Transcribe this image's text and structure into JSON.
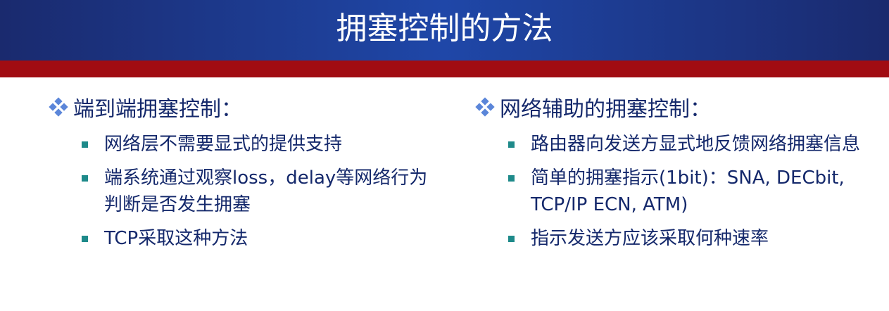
{
  "title": "拥塞控制的方法",
  "left": {
    "heading": "端到端拥塞控制：",
    "items": [
      "网络层不需要显式的提供支持",
      "端系统通过观察loss，delay等网络行为判断是否发生拥塞",
      "TCP采取这种方法"
    ]
  },
  "right": {
    "heading": "网络辅助的拥塞控制：",
    "items": [
      "路由器向发送方显式地反馈网络拥塞信息",
      "简单的拥塞指示(1bit)：SNA, DECbit, TCP/IP ECN, ATM)",
      "指示发送方应该采取何种速率"
    ]
  },
  "colors": {
    "header_blue": "#1f47a8",
    "red_band": "#a10c12",
    "text": "#14286b",
    "bullet_teal": "#1e8a8a",
    "diamond_blue": "#5b86d9"
  }
}
